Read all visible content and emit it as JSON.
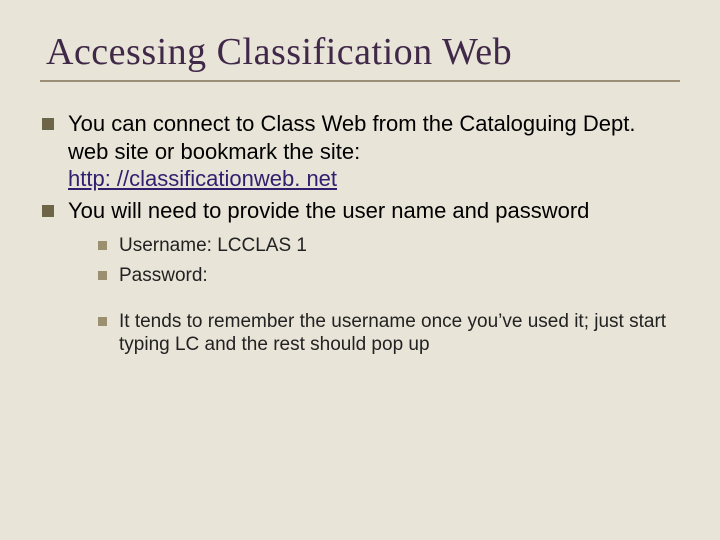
{
  "title": "Accessing Classification Web",
  "bullets": [
    {
      "pre": "You can connect to Class Web from the Cataloguing Dept. web site or bookmark the site: ",
      "link_text": "http: //classificationweb. net"
    },
    {
      "pre": "You will need to provide the user name and password"
    }
  ],
  "sub_bullets_a": [
    "Username: LCCLAS 1",
    "Password:"
  ],
  "sub_bullets_b": [
    "It tends to remember the username once you’ve used it; just start typing LC and the rest should pop up"
  ]
}
